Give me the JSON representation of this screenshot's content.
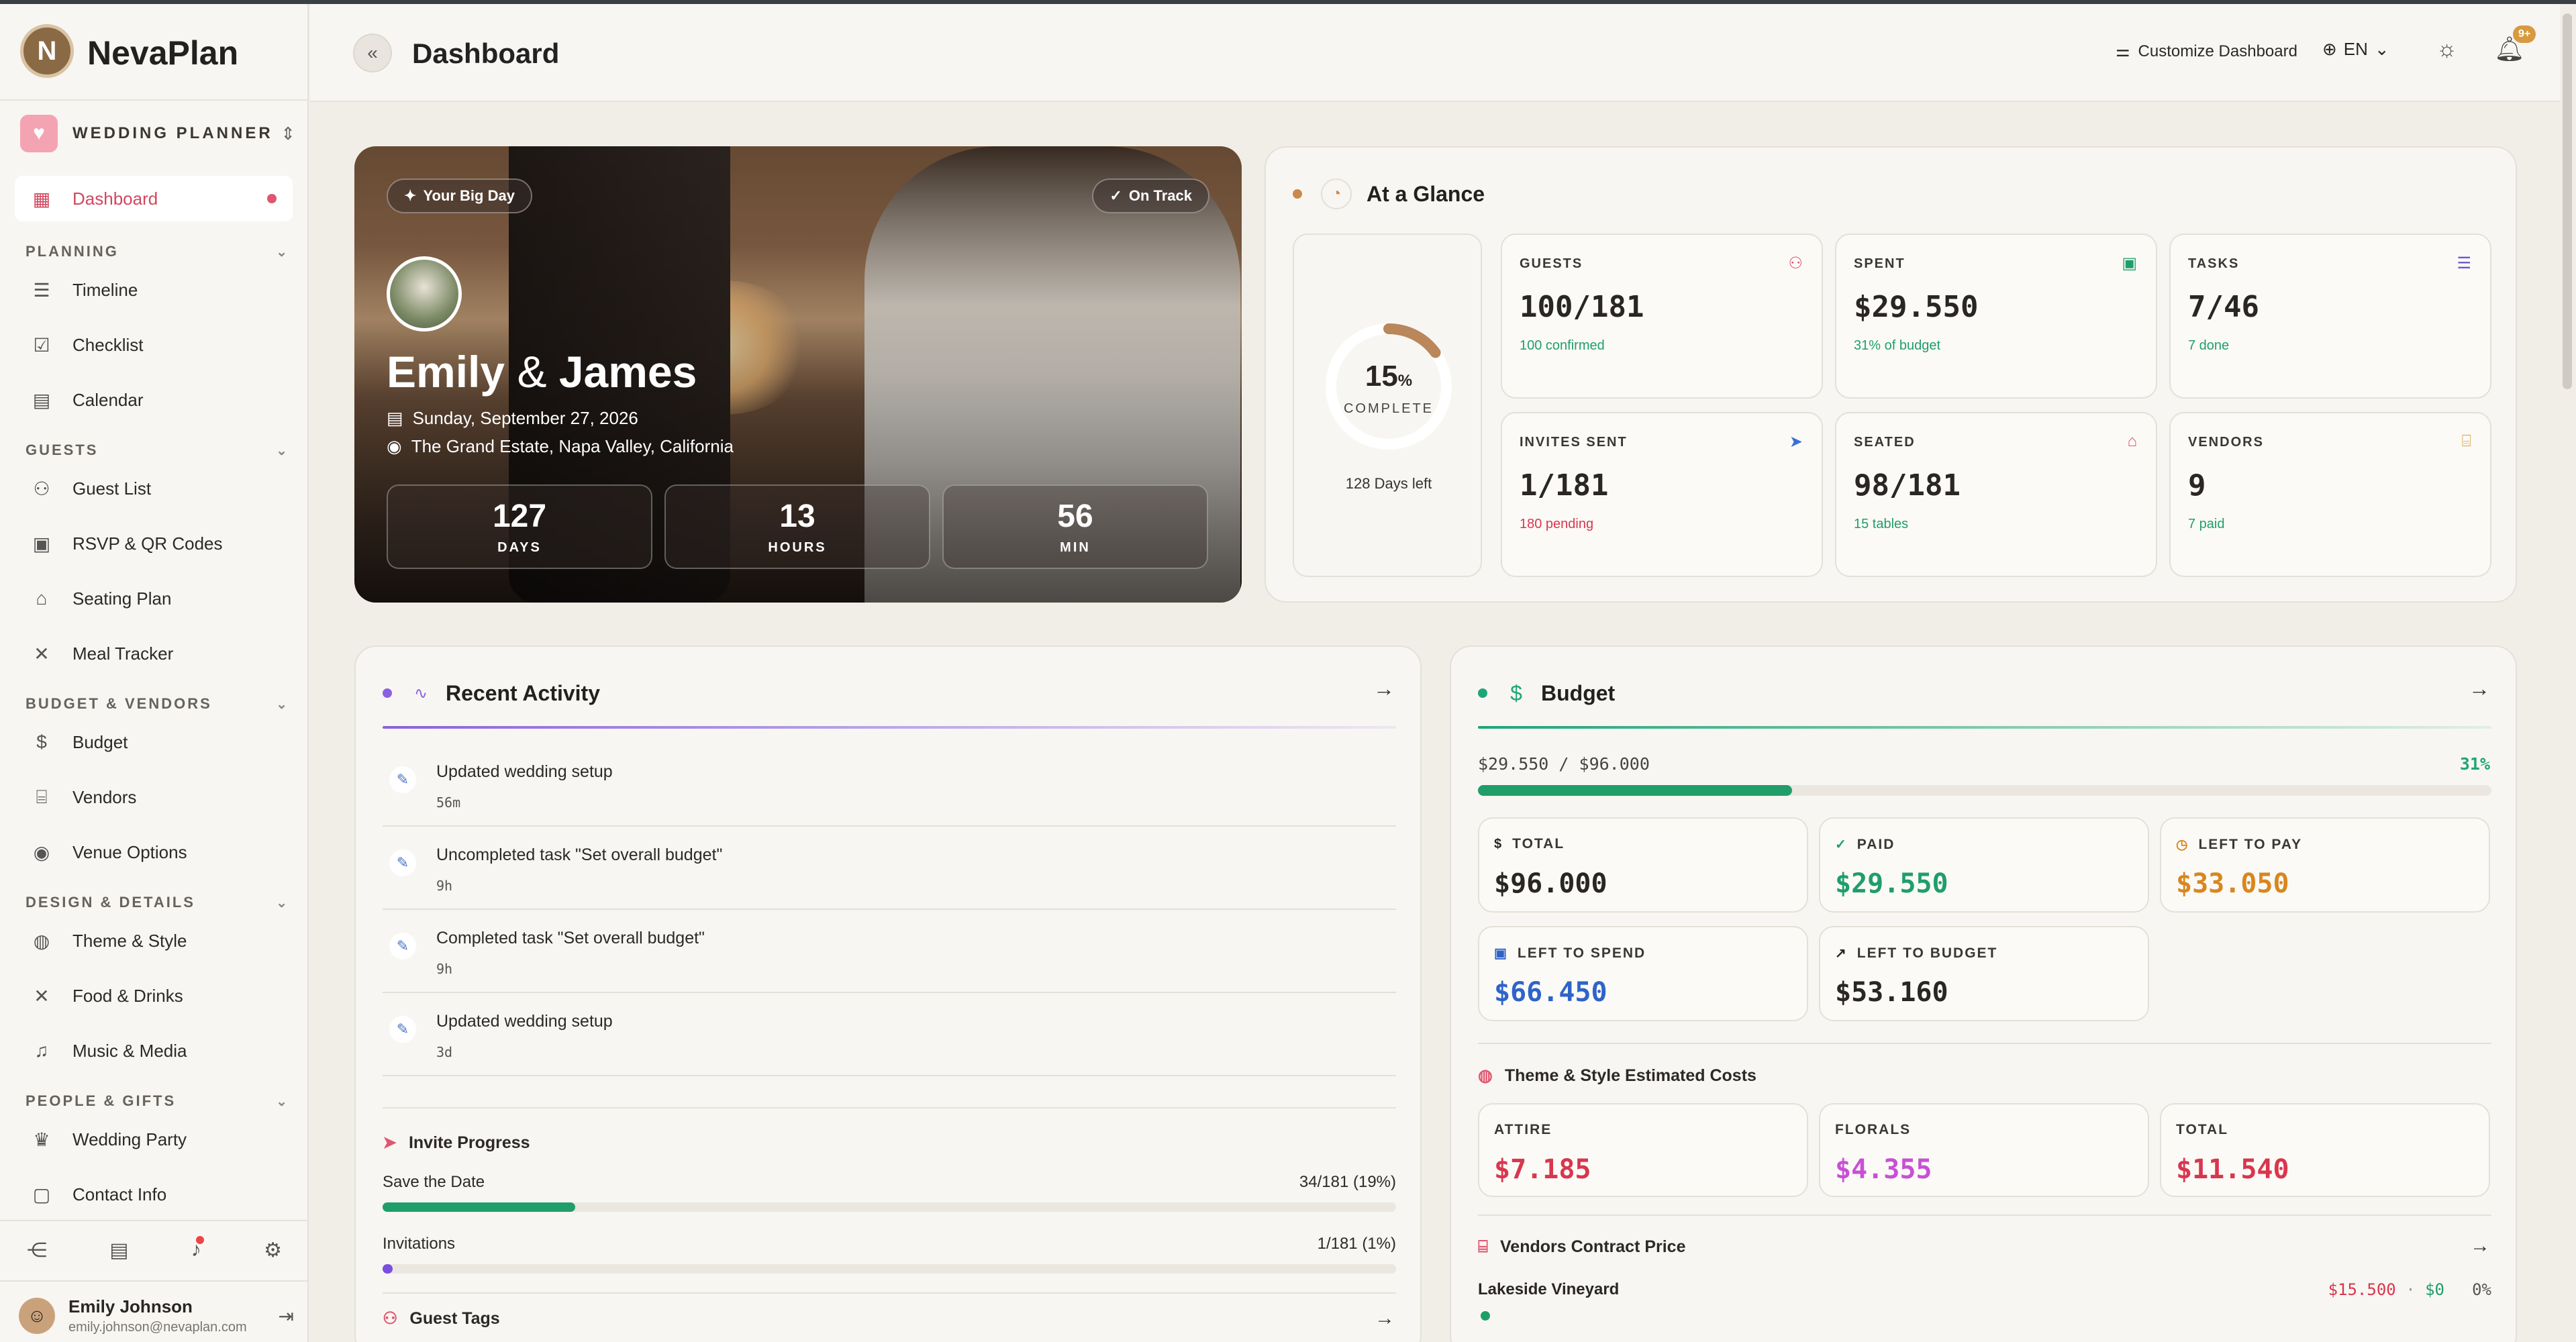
{
  "app": {
    "name": "NevaPlan",
    "logo_letter": "N"
  },
  "planner": {
    "label": "WEDDING PLANNER",
    "icon": "heart-icon",
    "accent": "#f4a3b2"
  },
  "sidebar": {
    "dashboard": "Dashboard",
    "sections": [
      {
        "label": "PLANNING",
        "items": [
          "Timeline",
          "Checklist",
          "Calendar"
        ]
      },
      {
        "label": "GUESTS",
        "items": [
          "Guest List",
          "RSVP & QR Codes",
          "Seating Plan",
          "Meal Tracker"
        ]
      },
      {
        "label": "BUDGET & VENDORS",
        "items": [
          "Budget",
          "Vendors",
          "Venue Options"
        ]
      },
      {
        "label": "DESIGN & DETAILS",
        "items": [
          "Theme & Style",
          "Food & Drinks",
          "Music & Media"
        ]
      },
      {
        "label": "PEOPLE & GIFTS",
        "items": [
          "Wedding Party",
          "Contact Info"
        ]
      }
    ]
  },
  "user": {
    "name": "Emily Johnson",
    "email": "emily.johnson@nevaplan.com"
  },
  "header": {
    "title": "Dashboard",
    "customize": "Customize Dashboard",
    "lang": "EN",
    "notif_badge": "9+"
  },
  "hero": {
    "badge_left": "Your Big Day",
    "badge_right": "On Track",
    "name1": "Emily",
    "amp": "&",
    "name2": "James",
    "date": "Sunday, September 27, 2026",
    "venue": "The Grand Estate, Napa Valley, California",
    "countdown": [
      {
        "value": "127",
        "label": "DAYS"
      },
      {
        "value": "13",
        "label": "HOURS"
      },
      {
        "value": "56",
        "label": "MIN"
      }
    ]
  },
  "glance": {
    "title": "At a Glance",
    "accent": "#c98a4b",
    "progress_fraction": 0.15,
    "percent": "15",
    "percent_sign": "%",
    "complete_label": "COMPLETE",
    "days_left": "128 Days left",
    "stats": [
      {
        "label": "GUESTS",
        "value": "100/181",
        "sub": "100 confirmed",
        "sub_color": "#1f9e6a",
        "icon": "users-icon",
        "icon_color": "#e0566f"
      },
      {
        "label": "SPENT",
        "value": "$29.550",
        "sub": "31% of budget",
        "sub_color": "#1f9e6a",
        "icon": "wallet-icon",
        "icon_color": "#1f9e6a"
      },
      {
        "label": "TASKS",
        "value": "7/46",
        "sub": "7 done",
        "sub_color": "#1f9e6a",
        "icon": "list-check-icon",
        "icon_color": "#6a5acd"
      },
      {
        "label": "INVITES SENT",
        "value": "1/181",
        "sub": "180 pending",
        "sub_color": "#d9364e",
        "icon": "send-icon",
        "icon_color": "#3b6fd4"
      },
      {
        "label": "SEATED",
        "value": "98/181",
        "sub": "15 tables",
        "sub_color": "#1f9e6a",
        "icon": "armchair-icon",
        "icon_color": "#e0566f"
      },
      {
        "label": "VENDORS",
        "value": "9",
        "sub": "7 paid",
        "sub_color": "#1f9e6a",
        "icon": "store-icon",
        "icon_color": "#e0a030"
      }
    ]
  },
  "activity": {
    "title": "Recent Activity",
    "items": [
      {
        "text": "Updated wedding setup",
        "time": "56m"
      },
      {
        "text": "Uncompleted task \"Set overall budget\"",
        "time": "9h"
      },
      {
        "text": "Completed task \"Set overall budget\"",
        "time": "9h"
      },
      {
        "text": "Updated wedding setup",
        "time": "3d"
      }
    ],
    "invite_title": "Invite Progress",
    "invites": [
      {
        "label": "Save the Date",
        "value": "34/181 (19%)",
        "fraction": 0.19,
        "color": "#1f9e6a"
      },
      {
        "label": "Invitations",
        "value": "1/181 (1%)",
        "fraction": 0.01,
        "color": "#7b4de0"
      }
    ],
    "tags_title": "Guest Tags"
  },
  "budget": {
    "title": "Budget",
    "summary": "$29.550 / $96.000",
    "percent": "31%",
    "fraction": 0.31,
    "tiles": [
      {
        "label": "TOTAL",
        "value": "$96.000",
        "color": "#2a2623",
        "icon": "dollar-icon"
      },
      {
        "label": "PAID",
        "value": "$29.550",
        "color": "#1f9e6a",
        "icon": "check-circle-icon"
      },
      {
        "label": "LEFT TO PAY",
        "value": "$33.050",
        "color": "#d9861f",
        "icon": "clock-icon"
      },
      {
        "label": "LEFT TO SPEND",
        "value": "$66.450",
        "color": "#2f63c8",
        "icon": "wallet-icon"
      },
      {
        "label": "LEFT TO BUDGET",
        "value": "$53.160",
        "color": "#2a2623",
        "icon": "trending-up-icon"
      }
    ],
    "theme_title": "Theme & Style Estimated Costs",
    "theme_tiles": [
      {
        "label": "ATTIRE",
        "value": "$7.185",
        "color": "#d9364e"
      },
      {
        "label": "FLORALS",
        "value": "$4.355",
        "color": "#c94fd6"
      },
      {
        "label": "TOTAL",
        "value": "$11.540",
        "color": "#d9364e"
      }
    ],
    "vendors_title": "Vendors Contract Price",
    "vendor_row": {
      "name": "Lakeside Vineyard",
      "price": "$15.500",
      "sep": "·",
      "paid": "$0",
      "pct": "0%"
    }
  }
}
